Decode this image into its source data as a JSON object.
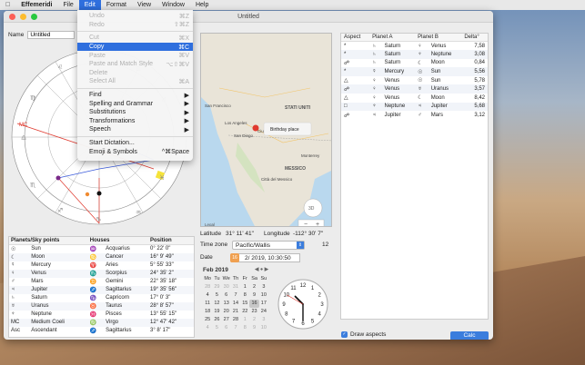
{
  "menubar": {
    "app": "Effemeridi",
    "items": [
      "File",
      "Edit",
      "Format",
      "View",
      "Window",
      "Help"
    ],
    "active": "Edit"
  },
  "window": {
    "title": "Untitled"
  },
  "name": {
    "label": "Name",
    "value": "Untitled"
  },
  "edit_menu": {
    "items": [
      {
        "label": "Undo",
        "shortcut": "⌘Z",
        "disabled": true
      },
      {
        "label": "Redo",
        "shortcut": "⇧⌘Z",
        "disabled": true
      },
      {
        "sep": true
      },
      {
        "label": "Cut",
        "shortcut": "⌘X",
        "disabled": true
      },
      {
        "label": "Copy",
        "shortcut": "⌘C",
        "highlighted": true
      },
      {
        "label": "Paste",
        "shortcut": "⌘V",
        "disabled": true
      },
      {
        "label": "Paste and Match Style",
        "shortcut": "⌥⇧⌘V",
        "disabled": true
      },
      {
        "label": "Delete",
        "shortcut": "",
        "disabled": true
      },
      {
        "label": "Select All",
        "shortcut": "⌘A",
        "disabled": true
      },
      {
        "sep": true
      },
      {
        "label": "Find",
        "shortcut": "▶"
      },
      {
        "label": "Spelling and Grammar",
        "shortcut": "▶"
      },
      {
        "label": "Substitutions",
        "shortcut": "▶"
      },
      {
        "label": "Transformations",
        "shortcut": "▶"
      },
      {
        "label": "Speech",
        "shortcut": "▶"
      },
      {
        "sep": true
      },
      {
        "label": "Start Dictation...",
        "shortcut": ""
      },
      {
        "label": "Emoji & Symbols",
        "shortcut": "^⌘Space"
      }
    ]
  },
  "planets_table": {
    "headers": [
      "Planets/Sky points",
      "Houses",
      "Position"
    ],
    "rows": [
      [
        "☉",
        "Sun",
        "♒",
        "Acquarius",
        "0° 22' 0\""
      ],
      [
        "☾",
        "Moon",
        "♋",
        "Cancer",
        "16° 9' 49\""
      ],
      [
        "☿",
        "Mercury",
        "♈",
        "Aries",
        "5° 55' 33\""
      ],
      [
        "♀",
        "Venus",
        "♏",
        "Scorpius",
        "24° 35' 2\""
      ],
      [
        "♂",
        "Mars",
        "♊",
        "Gemini",
        "22° 35' 18\""
      ],
      [
        "♃",
        "Jupiter",
        "♐",
        "Sagittarius",
        "19° 35' 56\""
      ],
      [
        "♄",
        "Saturn",
        "♑",
        "Capricorn",
        "17° 0' 3\""
      ],
      [
        "♅",
        "Uranus",
        "♉",
        "Taurus",
        "28° 8' 57\""
      ],
      [
        "♆",
        "Neptune",
        "♓",
        "Pisces",
        "13° 55' 15\""
      ],
      [
        "MC",
        "Medium Coeli",
        "♍",
        "Virgo",
        "12° 47' 42\""
      ],
      [
        "Asc",
        "Ascendant",
        "♐",
        "Sagittarius",
        "3° 8' 17\""
      ]
    ]
  },
  "map": {
    "labels": {
      "usa": "STATI UNITI",
      "sf": "San Francisco",
      "la": "Los Angeles",
      "sd": "San Diego",
      "ciudad": "Ciudad Juárez",
      "monterrey": "Monterrey",
      "messico": "MESSICO",
      "cdmx": "Città del Messico",
      "legal": "Legal"
    },
    "callout": "Birthday place",
    "zoom_label": "3D"
  },
  "location": {
    "latitude_label": "Latitude",
    "latitude": "31° 11' 41\"",
    "longitude_label": "Longitude",
    "longitude": "-112° 30' 7\""
  },
  "timezone": {
    "label": "Time zone",
    "value": "Pacific/Wallis",
    "offset": "12"
  },
  "date": {
    "label": "Date",
    "value": "2/ 2019, 10:30:50",
    "day_badge": "16"
  },
  "calendar": {
    "month": "Feb 2019",
    "days_header": [
      "Mo",
      "Tu",
      "We",
      "Th",
      "Fr",
      "Sa",
      "Su"
    ],
    "days": [
      "28",
      "29",
      "30",
      "31",
      "1",
      "2",
      "3",
      "4",
      "5",
      "6",
      "7",
      "8",
      "9",
      "10",
      "11",
      "12",
      "13",
      "14",
      "15",
      "16",
      "17",
      "18",
      "19",
      "20",
      "21",
      "22",
      "23",
      "24",
      "25",
      "26",
      "27",
      "28",
      "1",
      "2",
      "3",
      "4",
      "5",
      "6",
      "7",
      "8",
      "9",
      "10"
    ],
    "selected": "16"
  },
  "clock": {
    "numbers": [
      "12",
      "1",
      "2",
      "3",
      "4",
      "5",
      "6",
      "7",
      "8",
      "9",
      "10",
      "11"
    ],
    "hour": 10,
    "minute": 30,
    "second": 50
  },
  "aspects_table": {
    "headers": [
      "Aspect",
      "Planet A",
      "Planet B",
      "Delta°"
    ],
    "rows": [
      [
        "*",
        "♄",
        "Saturn",
        "♀",
        "Venus",
        "7,58"
      ],
      [
        "*",
        "♄",
        "Saturn",
        "♆",
        "Neptune",
        "3,08"
      ],
      [
        "☍",
        "♄",
        "Saturn",
        "☾",
        "Moon",
        "0,84"
      ],
      [
        "*",
        "☿",
        "Mercury",
        "☉",
        "Sun",
        "5,56"
      ],
      [
        "△",
        "♀",
        "Venus",
        "☉",
        "Sun",
        "5,78"
      ],
      [
        "☍",
        "♀",
        "Venus",
        "♅",
        "Uranus",
        "3,57"
      ],
      [
        "△",
        "♀",
        "Venus",
        "☾",
        "Moon",
        "8,42"
      ],
      [
        "□",
        "♆",
        "Neptune",
        "♃",
        "Jupiter",
        "5,68"
      ],
      [
        "☍",
        "♃",
        "Jupiter",
        "♂",
        "Mars",
        "3,12"
      ]
    ]
  },
  "draw_aspects": {
    "label": "Draw aspects",
    "checked": true
  },
  "calc_button": "Calc",
  "wheel": {
    "mc_label": "MC",
    "signs": [
      "♈",
      "♉",
      "♊",
      "♋",
      "♌",
      "♍",
      "♎",
      "♏",
      "♐",
      "♑",
      "♒",
      "♓"
    ]
  },
  "colors": {
    "accent": "#2f6fde",
    "aspect_red": "#e03a2f",
    "aspect_blue": "#3b5bdb"
  }
}
